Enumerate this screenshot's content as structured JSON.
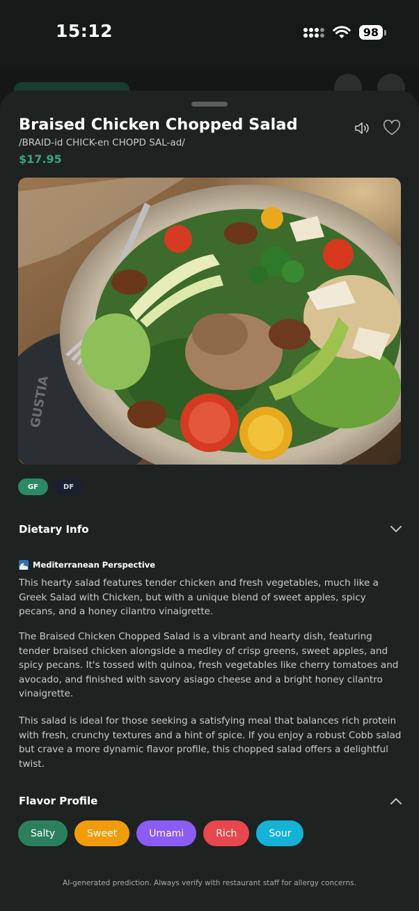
{
  "status": {
    "time": "15:12",
    "battery": "98"
  },
  "dish": {
    "title": "Braised Chicken Chopped Salad",
    "phonetic": "/BRAID-id CHICK-en CHOPD SAL-ad/",
    "price": "$17.95",
    "tags": [
      "GF",
      "DF"
    ],
    "image_alt": "Braised chicken chopped salad on a speckled plate with a fork"
  },
  "dietary": {
    "label": "Dietary Info",
    "perspective_title": "Mediterranean Perspective",
    "perspective_text": "This hearty salad features tender chicken and fresh vegetables, much like a Greek Salad with Chicken, but with a unique blend of sweet apples, spicy pecans, and a honey cilantro vinaigrette.",
    "description": "The Braised Chicken Chopped Salad is a vibrant and hearty dish, featuring tender braised chicken alongside a medley of crisp greens, sweet apples, and spicy pecans. It's tossed with quinoa, fresh vegetables like cherry tomatoes and avocado, and finished with savory asiago cheese and a bright honey cilantro vinaigrette.",
    "recommendation": "This salad is ideal for those seeking a satisfying meal that balances rich protein with fresh, crunchy textures and a hint of spice. If you enjoy a robust Cobb salad but crave a more dynamic flavor profile, this chopped salad offers a delightful twist."
  },
  "flavor": {
    "label": "Flavor Profile",
    "chips": [
      {
        "label": "Salty",
        "color": "#2b7f5d"
      },
      {
        "label": "Sweet",
        "color": "#f29c0b"
      },
      {
        "label": "Umami",
        "color": "#8b5cf6"
      },
      {
        "label": "Rich",
        "color": "#e7474d"
      },
      {
        "label": "Sour",
        "color": "#13b2d6"
      }
    ]
  },
  "disclaimer": "AI-generated prediction. Always verify with restaurant staff for allergy concerns.",
  "colors": {
    "accent": "#3aa57d",
    "sheet": "#1e2221",
    "background": "#141716"
  },
  "icons": [
    "speaker-icon",
    "heart-icon",
    "chevron-down-icon",
    "chevron-up-icon",
    "wave-icon"
  ]
}
